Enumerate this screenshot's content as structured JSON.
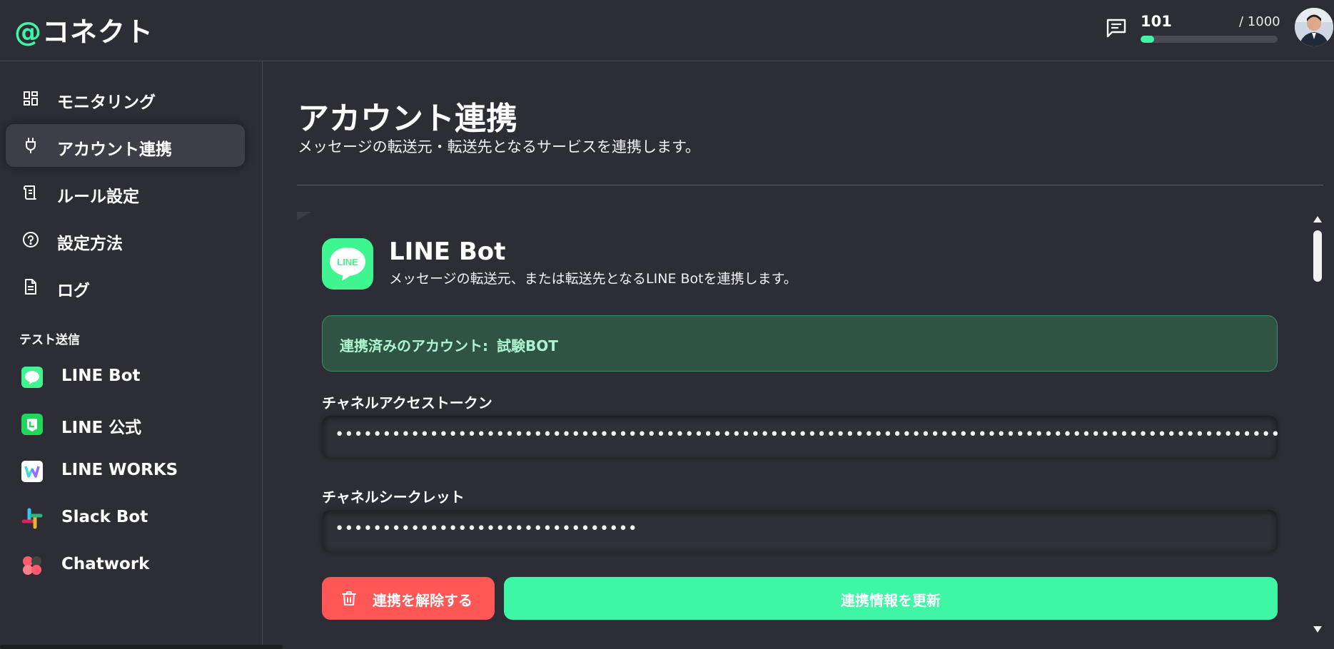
{
  "header": {
    "logo_at": "@",
    "logo_text": "コネクト",
    "usage_value": "101",
    "usage_max": "/ 1000",
    "usage_fraction": 0.101
  },
  "sidebar": {
    "nav": [
      {
        "label": "モニタリング",
        "icon": "dashboard-grid-icon"
      },
      {
        "label": "アカウント連携",
        "icon": "plug-icon",
        "active": true
      },
      {
        "label": "ルール設定",
        "icon": "scroll-icon"
      },
      {
        "label": "設定方法",
        "icon": "help-circle-icon"
      },
      {
        "label": "ログ",
        "icon": "document-icon"
      }
    ],
    "section_label": "テスト送信",
    "services": [
      {
        "label": "LINE Bot",
        "icon": "line-bot-icon"
      },
      {
        "label": "LINE 公式",
        "icon": "line-official-icon"
      },
      {
        "label": "LINE WORKS",
        "icon": "line-works-icon"
      },
      {
        "label": "Slack Bot",
        "icon": "slack-icon"
      },
      {
        "label": "Chatwork",
        "icon": "chatwork-icon"
      }
    ]
  },
  "main": {
    "title": "アカウント連携",
    "subtitle": "メッセージの転送元・転送先となるサービスを連携します。",
    "card": {
      "logo_text": "LINE",
      "title": "LINE Bot",
      "subtitle": "メッセージの転送元、または転送先となるLINE Botを連携します。",
      "connected_label": "連携済みのアカウント:",
      "connected_value": "試験BOT",
      "token_label": "チャネルアクセストークン",
      "token_value": "••••••••••••••••••••••••••••••••••••••••••••••••••••••••••••••••••••••••••••••••••••••••••••••••••••••••••••••••••••••",
      "secret_label": "チャネルシークレット",
      "secret_value": "••••••••••••••••••••••••••••••••",
      "unlink_label": "連携を解除する",
      "update_label": "連携情報を更新"
    }
  },
  "colors": {
    "accent": "#3ff5a6",
    "danger": "#ff5656",
    "background": "#2c2d35"
  }
}
